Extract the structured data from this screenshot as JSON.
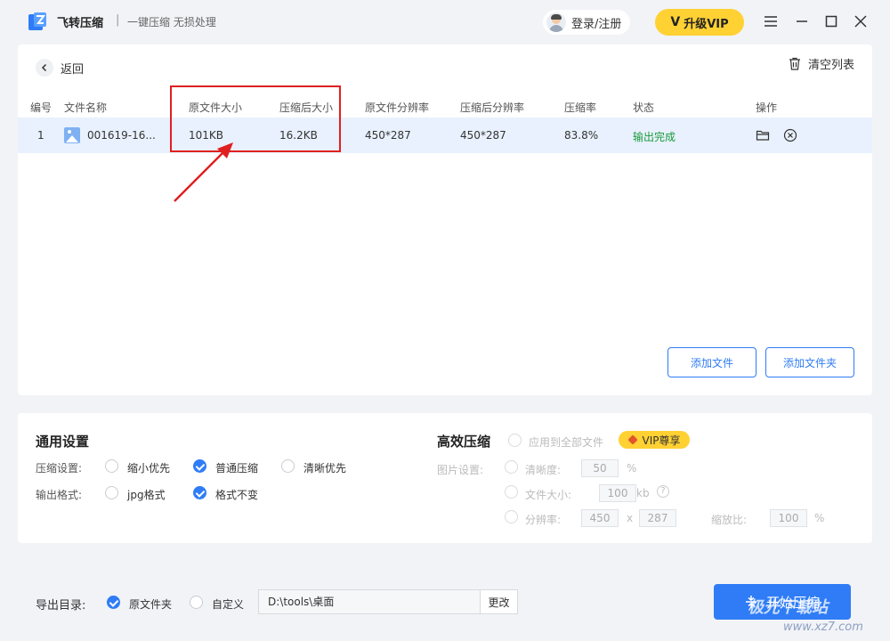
{
  "titlebar": {
    "app_name": "飞转压缩",
    "separator": "|",
    "slogan": "一键压缩 无损处理",
    "login_label": "登录/注册",
    "vip_label": "升级VIP",
    "vip_mark": "V",
    "icons": [
      "menu-icon",
      "minimize-icon",
      "maximize-icon",
      "close-icon"
    ]
  },
  "panel": {
    "back_label": "返回",
    "clear_label": "清空列表",
    "columns": [
      "编号",
      "文件名称",
      "原文件大小",
      "压缩后大小",
      "原文件分辨率",
      "压缩后分辨率",
      "压缩率",
      "状态",
      "操作"
    ],
    "rows": [
      {
        "index": "1",
        "name": "001619-16...",
        "original_size": "101KB",
        "compressed_size": "16.2KB",
        "original_resolution": "450*287",
        "compressed_resolution": "450*287",
        "ratio": "83.8%",
        "status": "输出完成"
      }
    ],
    "add_file_label": "添加文件",
    "add_folder_label": "添加文件夹"
  },
  "settings": {
    "general_title": "通用设置",
    "compress_label": "压缩设置:",
    "compress_options": [
      "缩小优先",
      "普通压缩",
      "清晰优先"
    ],
    "compress_selected": "普通压缩",
    "format_label": "输出格式:",
    "format_options": [
      "jpg格式",
      "格式不变"
    ],
    "format_selected": "格式不变",
    "efficient_title": "高效压缩",
    "apply_all_label": "应用到全部文件",
    "vip_badge": "VIP尊享",
    "image_settings_label": "图片设置:",
    "clarity_label": "清晰度:",
    "clarity_value": "50",
    "clarity_unit": "%",
    "filesize_label": "文件大小:",
    "filesize_value": "100",
    "filesize_unit": "kb",
    "help_mark": "?",
    "resolution_label": "分辨率:",
    "res_width": "450",
    "res_x": "x",
    "res_height": "287",
    "scale_label": "缩放比:",
    "scale_value": "100",
    "scale_unit": "%"
  },
  "bottom": {
    "outdir_label": "导出目录:",
    "outdir_options": [
      "原文件夹",
      "自定义"
    ],
    "outdir_selected": "原文件夹",
    "path_value": "D:\\tools\\桌面",
    "change_label": "更改",
    "start_label": "开始压缩"
  },
  "watermark": {
    "text": "极光下载站",
    "url": "www.xz7.com"
  },
  "colors": {
    "accent": "#2f7cf6",
    "vip": "#ffd133",
    "success": "#1a9a3b",
    "highlight": "#e02020",
    "row_selected": "#e8f1fd"
  }
}
